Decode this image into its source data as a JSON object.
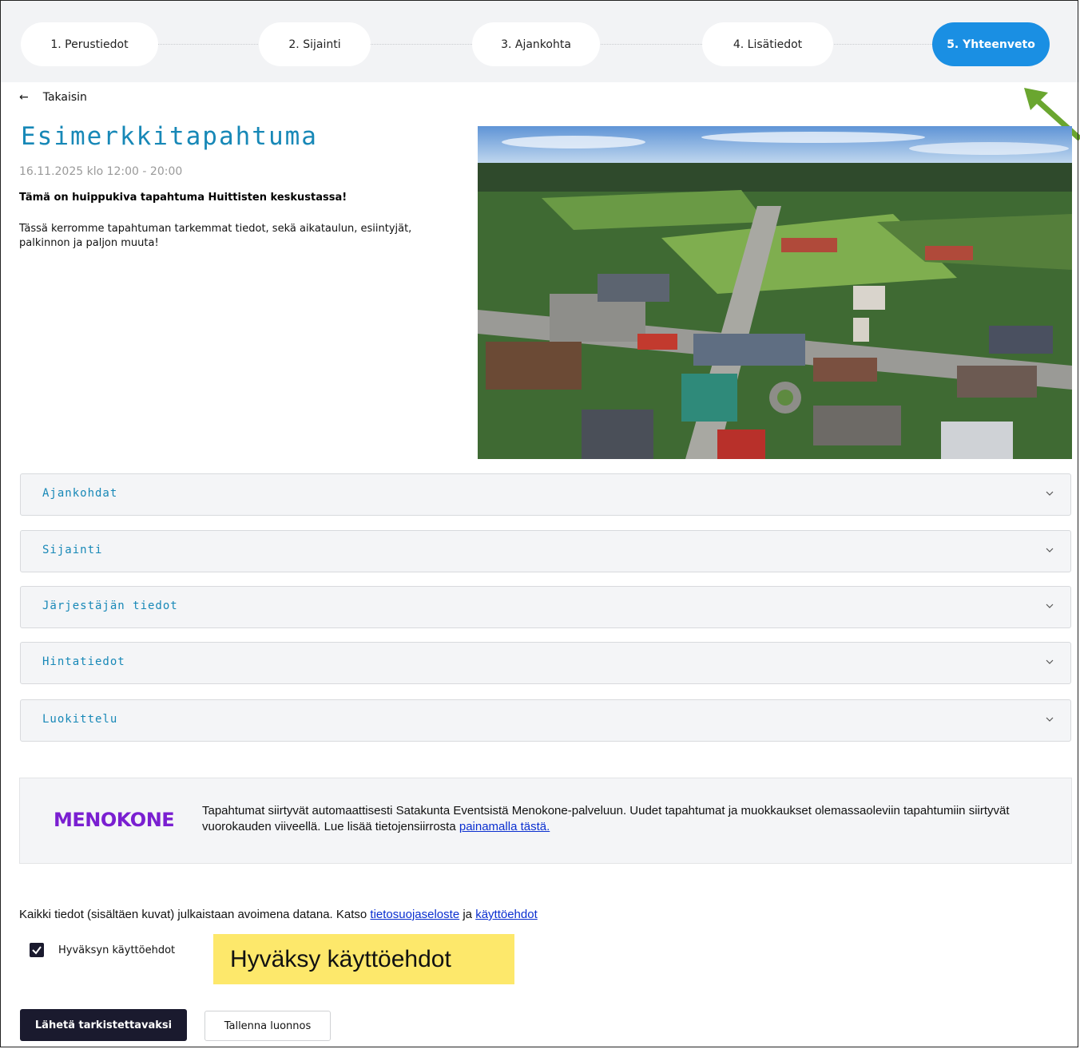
{
  "stepper": {
    "steps": [
      {
        "label": "1. Perustiedot"
      },
      {
        "label": "2. Sijainti"
      },
      {
        "label": "3. Ajankohta"
      },
      {
        "label": "4. Lisätiedot"
      },
      {
        "label": "5. Yhteenveto",
        "active": true
      }
    ]
  },
  "back": {
    "label": "Takaisin"
  },
  "event": {
    "title": "Esimerkkitapahtuma",
    "datetime": "16.11.2025 klo 12:00 - 20:00",
    "lead": "Tämä on huippukiva tapahtuma Huittisten keskustassa!",
    "description": "Tässä kerromme tapahtuman tarkemmat tiedot, sekä aikataulun, esiintyjät, palkinnon ja paljon muuta!"
  },
  "accordions": [
    {
      "label": "Ajankohdat"
    },
    {
      "label": "Sijainti"
    },
    {
      "label": "Järjestäjän tiedot"
    },
    {
      "label": "Hintatiedot"
    },
    {
      "label": "Luokittelu"
    }
  ],
  "menokone": {
    "logo": "MENOKONE",
    "text": "Tapahtumat siirtyvät automaattisesti Satakunta Eventsistä Menokone-palveluun. Uudet tapahtumat ja muokkaukset olemassaoleviin tapahtumiin siirtyvät vuorokauden viiveellä. Lue lisää tietojensiirrosta ",
    "link": "painamalla tästä."
  },
  "opendata": {
    "text": "Kaikki tiedot (sisältäen kuvat) julkaistaan avoimena datana. Katso ",
    "privacy_link": "tietosuojaseloste",
    "and": " ja ",
    "terms_link": "käyttöehdot"
  },
  "terms": {
    "label": "Hyväksyn käyttöehdot",
    "checked": true
  },
  "callout": {
    "text": "Hyväksy käyttöehdot"
  },
  "actions": {
    "submit": "Lähetä tarkistettavaksi",
    "save_draft": "Tallenna luonnos"
  },
  "colors": {
    "accent": "#1a8fe3",
    "title": "#1788b7",
    "dark": "#1a1a2e",
    "logo": "#7a1fd1",
    "callout": "#fde86b",
    "arrow": "#6aa62f"
  }
}
